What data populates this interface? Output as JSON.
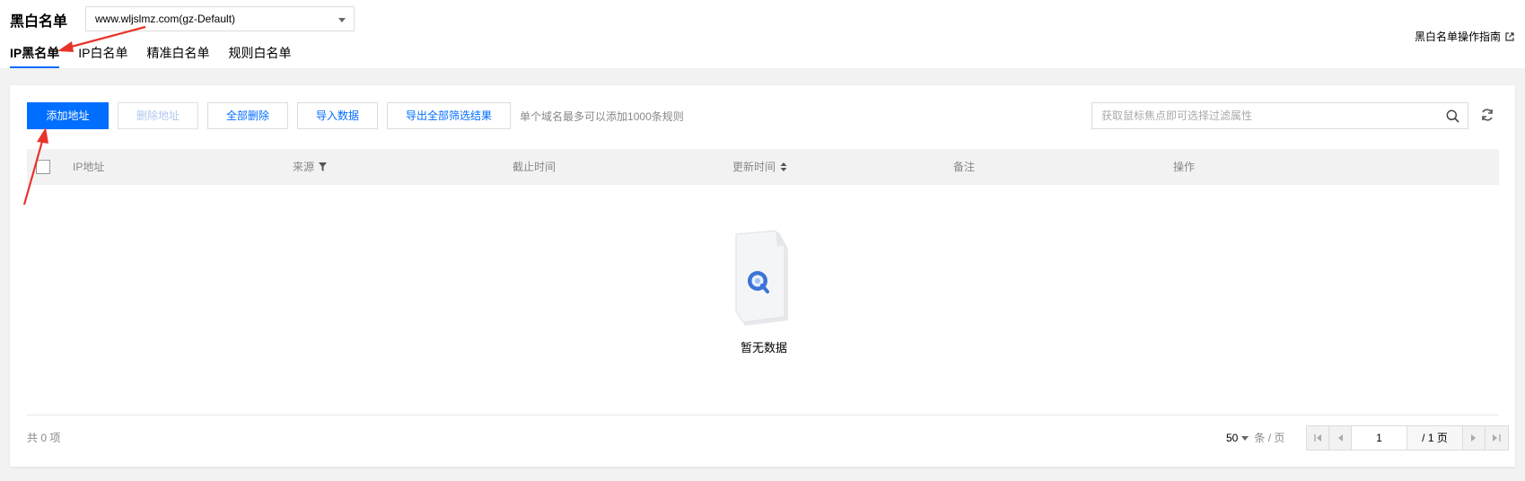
{
  "header": {
    "title": "黑白名单",
    "domain_select": "www.wljslmz.com(gz-Default)",
    "guide_link": "黑白名单操作指南"
  },
  "tabs": [
    {
      "label": "IP黑名单",
      "active": true
    },
    {
      "label": "IP白名单",
      "active": false
    },
    {
      "label": "精准白名单",
      "active": false
    },
    {
      "label": "规则白名单",
      "active": false
    }
  ],
  "toolbar": {
    "add": "添加地址",
    "delete": "删除地址",
    "delete_all": "全部删除",
    "import": "导入数据",
    "export": "导出全部筛选结果",
    "hint": "单个域名最多可以添加1000条规则"
  },
  "search": {
    "placeholder": "获取鼠标焦点即可选择过滤属性"
  },
  "table": {
    "columns": [
      "IP地址",
      "来源",
      "截止时间",
      "更新时间",
      "备注",
      "操作"
    ],
    "rows": []
  },
  "empty": {
    "text": "暂无数据"
  },
  "pagination": {
    "total": "共 0 项",
    "page_size": "50",
    "page_size_unit": "条 / 页",
    "current_page": "1",
    "total_pages": "/ 1 页"
  },
  "colors": {
    "accent": "#006eff",
    "annotation_arrow": "#e8332a"
  }
}
